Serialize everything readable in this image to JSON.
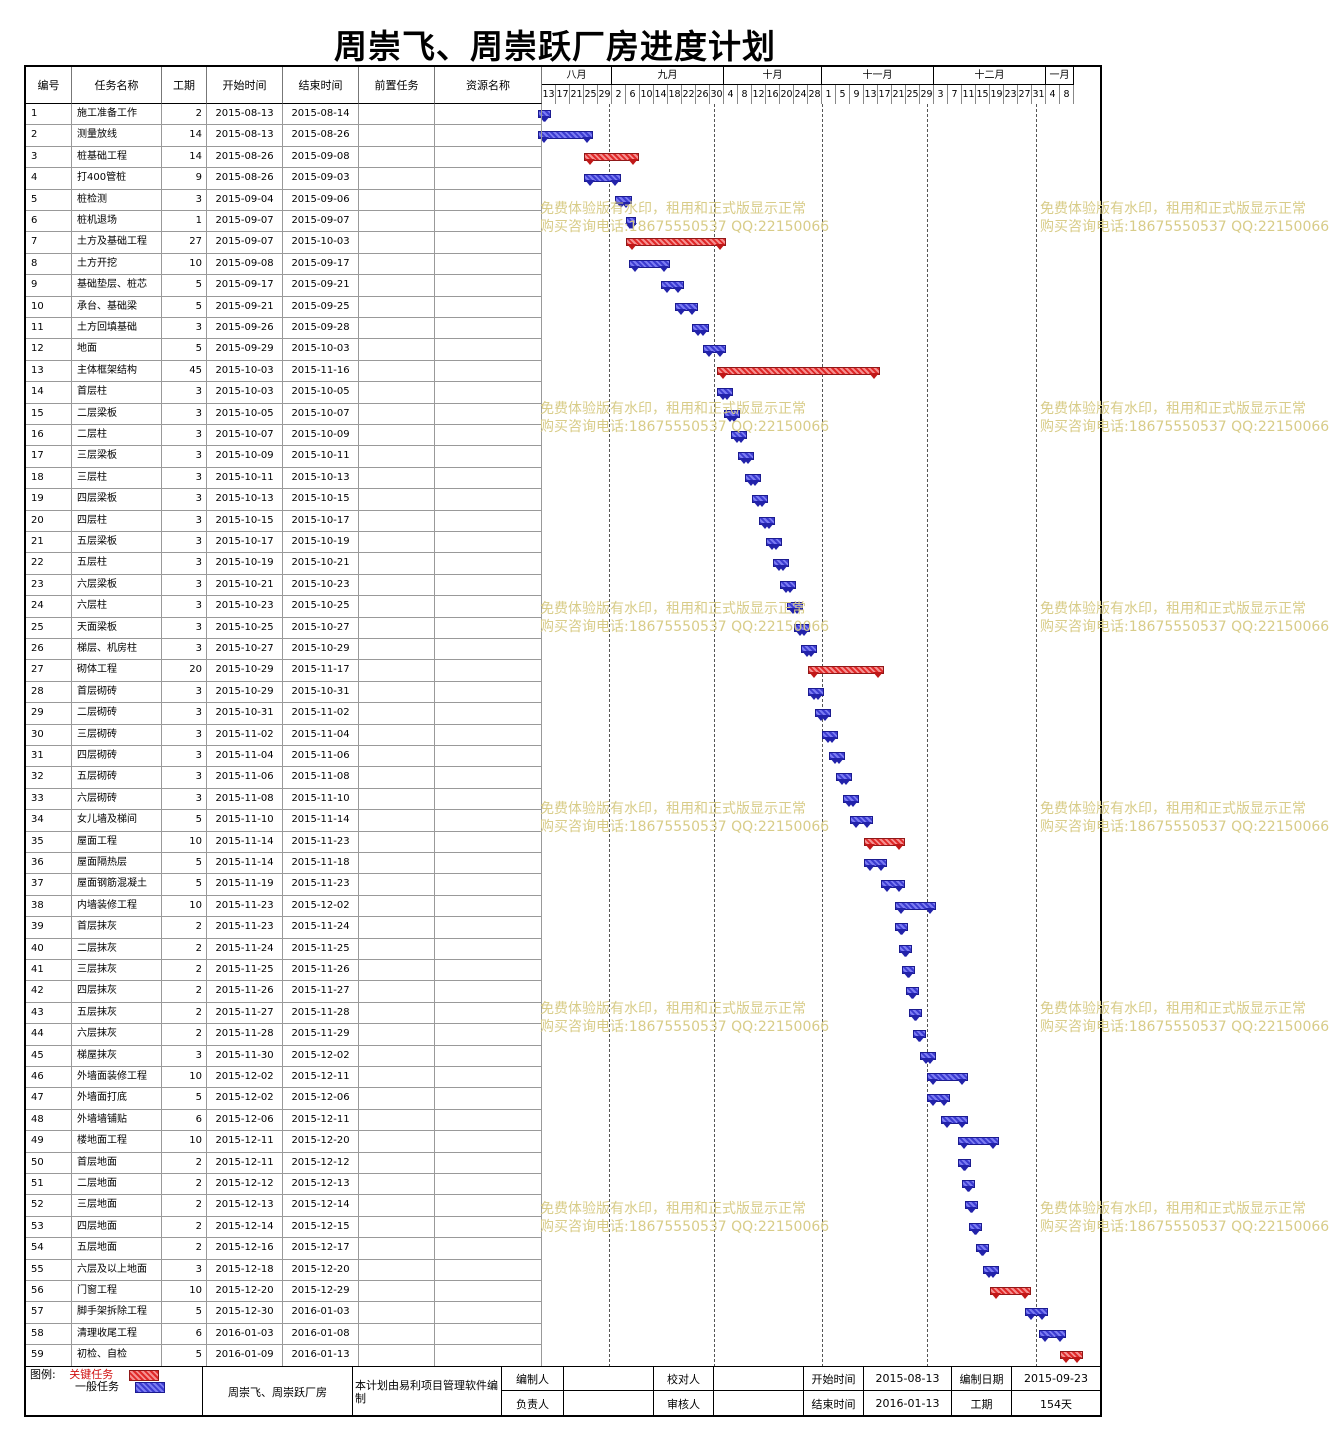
{
  "title": "周崇飞、周崇跃厂房进度计划",
  "columns": [
    "编号",
    "任务名称",
    "工期",
    "开始时间",
    "结束时间",
    "前置任务",
    "资源名称"
  ],
  "months": [
    {
      "label": "八月",
      "days": [
        "13",
        "17",
        "21",
        "25",
        "29"
      ]
    },
    {
      "label": "九月",
      "days": [
        "2",
        "6",
        "10",
        "14",
        "18",
        "22",
        "26",
        "30"
      ]
    },
    {
      "label": "十月",
      "days": [
        "4",
        "8",
        "12",
        "16",
        "20",
        "24",
        "28"
      ]
    },
    {
      "label": "十一月",
      "days": [
        "1",
        "5",
        "9",
        "13",
        "17",
        "21",
        "25",
        "29"
      ]
    },
    {
      "label": "十二月",
      "days": [
        "3",
        "7",
        "11",
        "15",
        "19",
        "23",
        "27",
        "31"
      ]
    },
    {
      "label": "一月",
      "days": [
        "4",
        "8"
      ]
    }
  ],
  "tasks": [
    {
      "id": "1",
      "name": "施工准备工作",
      "dur": "2",
      "start": "2015-08-13",
      "end": "2015-08-14",
      "type": "normal"
    },
    {
      "id": "2",
      "name": "测量放线",
      "dur": "14",
      "start": "2015-08-13",
      "end": "2015-08-26",
      "type": "normal"
    },
    {
      "id": "3",
      "name": "桩基础工程",
      "dur": "14",
      "start": "2015-08-26",
      "end": "2015-09-08",
      "type": "critical"
    },
    {
      "id": "4",
      "name": "打400管桩",
      "dur": "9",
      "start": "2015-08-26",
      "end": "2015-09-03",
      "type": "normal"
    },
    {
      "id": "5",
      "name": "桩检测",
      "dur": "3",
      "start": "2015-09-04",
      "end": "2015-09-06",
      "type": "normal"
    },
    {
      "id": "6",
      "name": "桩机退场",
      "dur": "1",
      "start": "2015-09-07",
      "end": "2015-09-07",
      "type": "normal"
    },
    {
      "id": "7",
      "name": "土方及基础工程",
      "dur": "27",
      "start": "2015-09-07",
      "end": "2015-10-03",
      "type": "critical"
    },
    {
      "id": "8",
      "name": "土方开挖",
      "dur": "10",
      "start": "2015-09-08",
      "end": "2015-09-17",
      "type": "normal"
    },
    {
      "id": "9",
      "name": "基础垫层、桩芯",
      "dur": "5",
      "start": "2015-09-17",
      "end": "2015-09-21",
      "type": "normal"
    },
    {
      "id": "10",
      "name": "承台、基础梁",
      "dur": "5",
      "start": "2015-09-21",
      "end": "2015-09-25",
      "type": "normal"
    },
    {
      "id": "11",
      "name": "土方回填基础",
      "dur": "3",
      "start": "2015-09-26",
      "end": "2015-09-28",
      "type": "normal"
    },
    {
      "id": "12",
      "name": "地面",
      "dur": "5",
      "start": "2015-09-29",
      "end": "2015-10-03",
      "type": "normal"
    },
    {
      "id": "13",
      "name": "主体框架结构",
      "dur": "45",
      "start": "2015-10-03",
      "end": "2015-11-16",
      "type": "critical"
    },
    {
      "id": "14",
      "name": "首层柱",
      "dur": "3",
      "start": "2015-10-03",
      "end": "2015-10-05",
      "type": "normal"
    },
    {
      "id": "15",
      "name": "二层梁板",
      "dur": "3",
      "start": "2015-10-05",
      "end": "2015-10-07",
      "type": "normal"
    },
    {
      "id": "16",
      "name": "二层柱",
      "dur": "3",
      "start": "2015-10-07",
      "end": "2015-10-09",
      "type": "normal"
    },
    {
      "id": "17",
      "name": "三层梁板",
      "dur": "3",
      "start": "2015-10-09",
      "end": "2015-10-11",
      "type": "normal"
    },
    {
      "id": "18",
      "name": "三层柱",
      "dur": "3",
      "start": "2015-10-11",
      "end": "2015-10-13",
      "type": "normal"
    },
    {
      "id": "19",
      "name": "四层梁板",
      "dur": "3",
      "start": "2015-10-13",
      "end": "2015-10-15",
      "type": "normal"
    },
    {
      "id": "20",
      "name": "四层柱",
      "dur": "3",
      "start": "2015-10-15",
      "end": "2015-10-17",
      "type": "normal"
    },
    {
      "id": "21",
      "name": "五层梁板",
      "dur": "3",
      "start": "2015-10-17",
      "end": "2015-10-19",
      "type": "normal"
    },
    {
      "id": "22",
      "name": "五层柱",
      "dur": "3",
      "start": "2015-10-19",
      "end": "2015-10-21",
      "type": "normal"
    },
    {
      "id": "23",
      "name": "六层梁板",
      "dur": "3",
      "start": "2015-10-21",
      "end": "2015-10-23",
      "type": "normal"
    },
    {
      "id": "24",
      "name": "六层柱",
      "dur": "3",
      "start": "2015-10-23",
      "end": "2015-10-25",
      "type": "normal"
    },
    {
      "id": "25",
      "name": "天面梁板",
      "dur": "3",
      "start": "2015-10-25",
      "end": "2015-10-27",
      "type": "normal"
    },
    {
      "id": "26",
      "name": "梯层、机房柱",
      "dur": "3",
      "start": "2015-10-27",
      "end": "2015-10-29",
      "type": "normal"
    },
    {
      "id": "27",
      "name": "砌体工程",
      "dur": "20",
      "start": "2015-10-29",
      "end": "2015-11-17",
      "type": "critical"
    },
    {
      "id": "28",
      "name": "首层砌砖",
      "dur": "3",
      "start": "2015-10-29",
      "end": "2015-10-31",
      "type": "normal"
    },
    {
      "id": "29",
      "name": "二层砌砖",
      "dur": "3",
      "start": "2015-10-31",
      "end": "2015-11-02",
      "type": "normal"
    },
    {
      "id": "30",
      "name": "三层砌砖",
      "dur": "3",
      "start": "2015-11-02",
      "end": "2015-11-04",
      "type": "normal"
    },
    {
      "id": "31",
      "name": "四层砌砖",
      "dur": "3",
      "start": "2015-11-04",
      "end": "2015-11-06",
      "type": "normal"
    },
    {
      "id": "32",
      "name": "五层砌砖",
      "dur": "3",
      "start": "2015-11-06",
      "end": "2015-11-08",
      "type": "normal"
    },
    {
      "id": "33",
      "name": "六层砌砖",
      "dur": "3",
      "start": "2015-11-08",
      "end": "2015-11-10",
      "type": "normal"
    },
    {
      "id": "34",
      "name": "女儿墙及梯间",
      "dur": "5",
      "start": "2015-11-10",
      "end": "2015-11-14",
      "type": "normal"
    },
    {
      "id": "35",
      "name": "屋面工程",
      "dur": "10",
      "start": "2015-11-14",
      "end": "2015-11-23",
      "type": "critical"
    },
    {
      "id": "36",
      "name": "屋面隔热层",
      "dur": "5",
      "start": "2015-11-14",
      "end": "2015-11-18",
      "type": "normal"
    },
    {
      "id": "37",
      "name": "屋面钢筋混凝土",
      "dur": "5",
      "start": "2015-11-19",
      "end": "2015-11-23",
      "type": "normal"
    },
    {
      "id": "38",
      "name": "内墙装修工程",
      "dur": "10",
      "start": "2015-11-23",
      "end": "2015-12-02",
      "type": "normal"
    },
    {
      "id": "39",
      "name": "首层抹灰",
      "dur": "2",
      "start": "2015-11-23",
      "end": "2015-11-24",
      "type": "normal"
    },
    {
      "id": "40",
      "name": "二层抹灰",
      "dur": "2",
      "start": "2015-11-24",
      "end": "2015-11-25",
      "type": "normal"
    },
    {
      "id": "41",
      "name": "三层抹灰",
      "dur": "2",
      "start": "2015-11-25",
      "end": "2015-11-26",
      "type": "normal"
    },
    {
      "id": "42",
      "name": "四层抹灰",
      "dur": "2",
      "start": "2015-11-26",
      "end": "2015-11-27",
      "type": "normal"
    },
    {
      "id": "43",
      "name": "五层抹灰",
      "dur": "2",
      "start": "2015-11-27",
      "end": "2015-11-28",
      "type": "normal"
    },
    {
      "id": "44",
      "name": "六层抹灰",
      "dur": "2",
      "start": "2015-11-28",
      "end": "2015-11-29",
      "type": "normal"
    },
    {
      "id": "45",
      "name": "梯屋抹灰",
      "dur": "3",
      "start": "2015-11-30",
      "end": "2015-12-02",
      "type": "normal"
    },
    {
      "id": "46",
      "name": "外墙面装修工程",
      "dur": "10",
      "start": "2015-12-02",
      "end": "2015-12-11",
      "type": "normal"
    },
    {
      "id": "47",
      "name": "外墙面打底",
      "dur": "5",
      "start": "2015-12-02",
      "end": "2015-12-06",
      "type": "normal"
    },
    {
      "id": "48",
      "name": "外墙墙铺贴",
      "dur": "6",
      "start": "2015-12-06",
      "end": "2015-12-11",
      "type": "normal"
    },
    {
      "id": "49",
      "name": "楼地面工程",
      "dur": "10",
      "start": "2015-12-11",
      "end": "2015-12-20",
      "type": "normal"
    },
    {
      "id": "50",
      "name": "首层地面",
      "dur": "2",
      "start": "2015-12-11",
      "end": "2015-12-12",
      "type": "normal"
    },
    {
      "id": "51",
      "name": "二层地面",
      "dur": "2",
      "start": "2015-12-12",
      "end": "2015-12-13",
      "type": "normal"
    },
    {
      "id": "52",
      "name": "三层地面",
      "dur": "2",
      "start": "2015-12-13",
      "end": "2015-12-14",
      "type": "normal"
    },
    {
      "id": "53",
      "name": "四层地面",
      "dur": "2",
      "start": "2015-12-14",
      "end": "2015-12-15",
      "type": "normal"
    },
    {
      "id": "54",
      "name": "五层地面",
      "dur": "2",
      "start": "2015-12-16",
      "end": "2015-12-17",
      "type": "normal"
    },
    {
      "id": "55",
      "name": "六层及以上地面",
      "dur": "3",
      "start": "2015-12-18",
      "end": "2015-12-20",
      "type": "normal"
    },
    {
      "id": "56",
      "name": "门窗工程",
      "dur": "10",
      "start": "2015-12-20",
      "end": "2015-12-29",
      "type": "critical"
    },
    {
      "id": "57",
      "name": "脚手架拆除工程",
      "dur": "5",
      "start": "2015-12-30",
      "end": "2016-01-03",
      "type": "normal"
    },
    {
      "id": "58",
      "name": "清理收尾工程",
      "dur": "6",
      "start": "2016-01-03",
      "end": "2016-01-08",
      "type": "normal"
    },
    {
      "id": "59",
      "name": "初检、自检",
      "dur": "5",
      "start": "2016-01-09",
      "end": "2016-01-13",
      "type": "critical"
    }
  ],
  "watermark": {
    "line1": "免费体验版有水印，租用和正式版显示正常",
    "line2": "购买咨询电话:18675550537 QQ:22150066"
  },
  "footer": {
    "legend_label": "图例:",
    "legend_critical": "关键任务",
    "legend_normal": "一般任务",
    "project": "周崇飞、周崇跃厂房",
    "software_note": "本计划由易利项目管理软件编制",
    "compiler_label": "编制人",
    "compiler_value": "",
    "reviewer_label": "校对人",
    "reviewer_value": "",
    "owner_label": "负责人",
    "owner_value": "",
    "auditor_label": "审核人",
    "auditor_value": "",
    "start_label": "开始时间",
    "start_value": "2015-08-13",
    "end_label": "结束时间",
    "end_value": "2016-01-13",
    "date_label": "编制日期",
    "date_value": "2015-09-23",
    "duration_label": "工期",
    "duration_value": "154天"
  },
  "colors": {
    "critical": "#e02828",
    "normal": "#3b3bd0",
    "watermark": "#d8cc88"
  }
}
